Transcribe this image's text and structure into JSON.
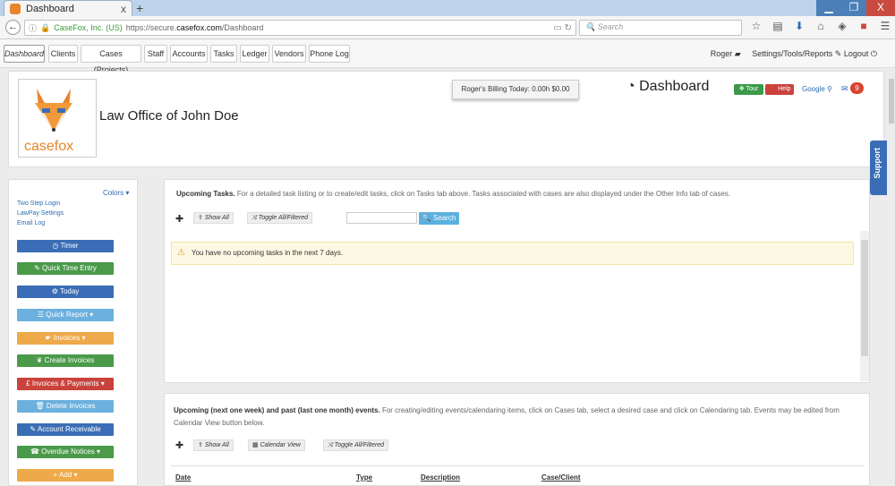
{
  "browser": {
    "tab_title": "Dashboard",
    "tab_close": "x",
    "new_tab": "+",
    "win_min": "▁",
    "win_max": "❐",
    "win_close": "X",
    "url_org": "CaseFox, Inc. (US)",
    "url_prefix": "https://secure.",
    "url_domain": "casefox.com",
    "url_path": "/Dashboard",
    "search_placeholder": "Search"
  },
  "nav": {
    "tabs": [
      "Dashboard",
      "Clients",
      "Cases (Projects)",
      "Staff",
      "Accounts",
      "Tasks",
      "Ledger",
      "Vendors",
      "Phone Log"
    ],
    "user": "Roger",
    "settings": "Settings/Tools/Reports",
    "logout": "Logout"
  },
  "header": {
    "firm_name": "Law Office of John Doe",
    "billing": "Roger's Billing Today: 0.00h $0.00",
    "page_title": "Dashboard",
    "tour": "Tour",
    "help": "Help",
    "google": "Google",
    "badge_count": "9",
    "logo_text": "casefox"
  },
  "sidebar": {
    "colors": "Colors",
    "links": [
      "Two Step Login",
      "LawPay Settings",
      "Email Log"
    ],
    "buttons": [
      {
        "label": "Timer",
        "color": "blue"
      },
      {
        "label": "Quick Time Entry",
        "color": "green"
      },
      {
        "label": "Today",
        "color": "blue"
      },
      {
        "label": "Quick Report",
        "color": "lblue"
      },
      {
        "label": "Invoices",
        "color": "orange"
      },
      {
        "label": "Create Invoices",
        "color": "green"
      },
      {
        "label": "Invoices & Payments",
        "color": "red"
      },
      {
        "label": "Delete Invoices",
        "color": "lblue"
      },
      {
        "label": "Account Receivable",
        "color": "blue"
      },
      {
        "label": "Overdue Notices",
        "color": "green"
      },
      {
        "label": "Add",
        "color": "orange"
      }
    ]
  },
  "tasks_panel": {
    "title": "Upcoming Tasks.",
    "description": "For a detailed task listing or to create/edit tasks, click on Tasks tab above. Tasks associated with cases are also displayed under the Other Info tab of cases.",
    "show_all": "Show All",
    "toggle": "Toggle All/Filtered",
    "search_btn": "Search",
    "alert": "You have no upcoming tasks in the next 7 days."
  },
  "events_panel": {
    "title": "Upcoming (next one week) and past (last one month) events.",
    "description": "For creating/editing events/calendaring items, click on Cases tab, select a desired case and click on Calendaring tab. Events may be edited from Calendar View button below.",
    "show_all": "Show All",
    "calendar_view": "Calendar View",
    "toggle": "Toggle All/Filtered",
    "columns": [
      "Date",
      "Type",
      "Description",
      "Case/Client"
    ]
  },
  "support": "Support",
  "colors": {
    "blue": "#3a6db5",
    "green": "#4a9a4a",
    "lblue": "#6bb0de",
    "orange": "#eea94a",
    "red": "#c9433c"
  }
}
